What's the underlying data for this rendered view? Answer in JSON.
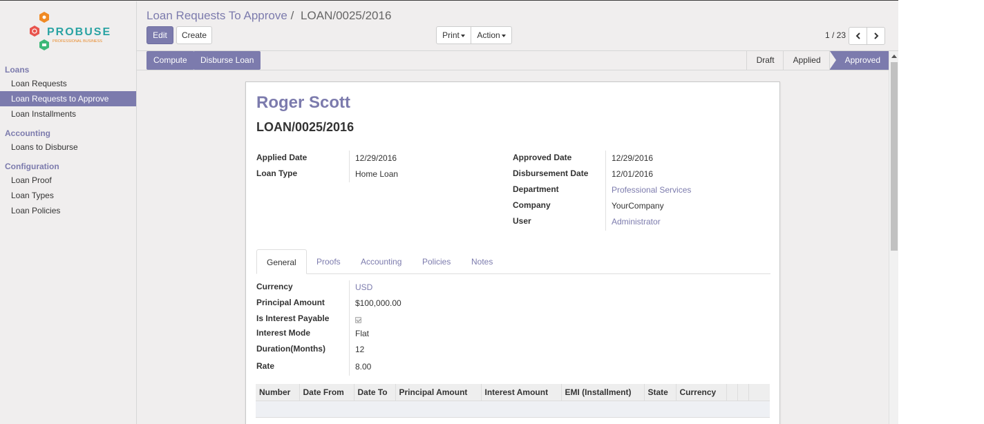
{
  "brand": {
    "name": "PROBUSE",
    "tagline": "PROFESSIONAL BUSINESS"
  },
  "sidebar": {
    "sections": [
      {
        "title": "Loans",
        "items": [
          "Loan Requests",
          "Loan Requests to Approve",
          "Loan Installments"
        ]
      },
      {
        "title": "Accounting",
        "items": [
          "Loans to Disburse"
        ]
      },
      {
        "title": "Configuration",
        "items": [
          "Loan Proof",
          "Loan Types",
          "Loan Policies"
        ]
      }
    ],
    "active_item": "Loan Requests to Approve"
  },
  "breadcrumb": {
    "parent": "Loan Requests To Approve",
    "separator": "/",
    "current": "LOAN/0025/2016"
  },
  "toolbar": {
    "edit": "Edit",
    "create": "Create",
    "print": "Print",
    "action": "Action"
  },
  "pager": {
    "value": "1 / 23"
  },
  "statusbar": {
    "buttons": [
      "Compute",
      "Disburse Loan"
    ],
    "stages": [
      "Draft",
      "Applied",
      "Approved"
    ],
    "active_stage": "Approved"
  },
  "record": {
    "employee": "Roger Scott",
    "number": "LOAN/0025/2016",
    "left_fields": [
      {
        "label": "Applied Date",
        "value": "12/29/2016"
      },
      {
        "label": "Loan Type",
        "value": "Home Loan"
      }
    ],
    "right_fields": [
      {
        "label": "Approved Date",
        "value": "12/29/2016"
      },
      {
        "label": "Disbursement Date",
        "value": "12/01/2016"
      },
      {
        "label": "Department",
        "value": "Professional Services"
      },
      {
        "label": "Company",
        "value": "YourCompany"
      },
      {
        "label": "User",
        "value": "Administrator"
      }
    ]
  },
  "tabs": [
    "General",
    "Proofs",
    "Accounting",
    "Policies",
    "Notes"
  ],
  "active_tab": "General",
  "general": {
    "currency": {
      "label": "Currency",
      "value": "USD"
    },
    "principal": {
      "label": "Principal Amount",
      "value": "$100,000.00"
    },
    "interest_payable": {
      "label": "Is Interest Payable",
      "checked": true
    },
    "interest_mode": {
      "label": "Interest Mode",
      "value": "Flat"
    },
    "duration": {
      "label": "Duration(Months)",
      "value": "12"
    },
    "rate": {
      "label": "Rate",
      "value": "8.00"
    }
  },
  "installments_table": {
    "columns": [
      "Number",
      "Date From",
      "Date To",
      "Principal Amount",
      "Interest Amount",
      "EMI (Installment)",
      "State",
      "Currency",
      "",
      "",
      ""
    ]
  },
  "colors": {
    "accent": "#7c7bad",
    "background": "#f0eeee"
  }
}
